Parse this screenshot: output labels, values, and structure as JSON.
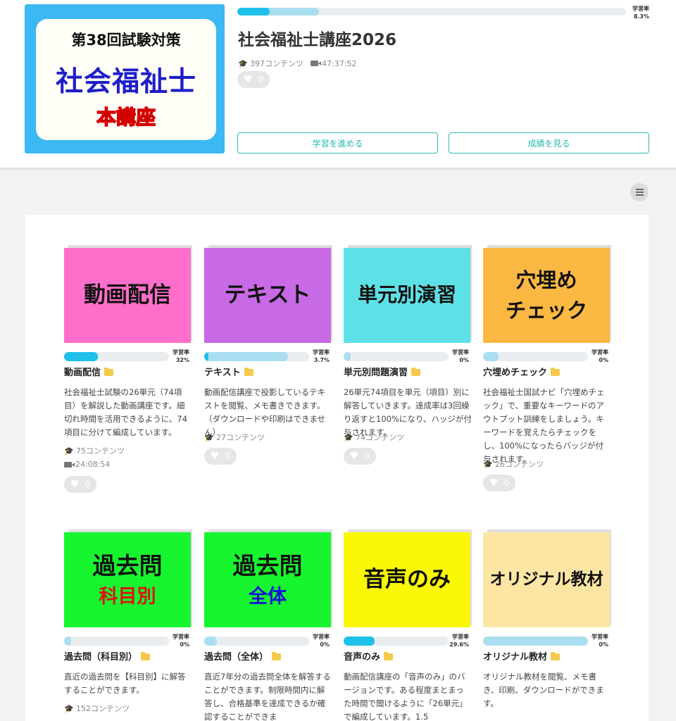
{
  "course": {
    "thumbnail": {
      "line1": "第38回試験対策",
      "line2": "社会福祉士",
      "line3": "本講座"
    },
    "title": "社会福祉士講座2026",
    "contents": "397コンテンツ",
    "duration": "47:37:52",
    "likes": "0",
    "progress": {
      "rate_label": "学習率",
      "rate": "8.3%",
      "fill": 0.083,
      "buffer": 0.21
    }
  },
  "buttons": {
    "study": "学習を進める",
    "score": "成績を見る"
  },
  "icons": {
    "contents": "graduation-cap-icon",
    "duration": "video-camera-icon",
    "like": "heart-icon",
    "folder": "folder-icon",
    "list": "list-icon"
  },
  "colors": {
    "accent": "#29b8b0",
    "progress": "#1fc0ea",
    "progress_buffer": "#a9def0"
  },
  "cards": [
    {
      "thumb_lines": [
        "動画配信"
      ],
      "thumb_bg": "#ff6ecb",
      "title": "動画配信",
      "rate_label": "学習率",
      "rate": "32%",
      "fill": 0.32,
      "buffer": 0.32,
      "desc": "社会福祉士試験の26単元（74項目）を解説した動画講座です。細切れ時間を活用できるように、74項目に分けて編成しています。",
      "contents": "75コンテンツ",
      "duration": "24:08:54",
      "likes": "0"
    },
    {
      "thumb_lines": [
        "テキスト"
      ],
      "thumb_bg": "#c86ae6",
      "title": "テキスト",
      "rate_label": "学習率",
      "rate": "3.7%",
      "fill": 0.037,
      "buffer": 0.8,
      "desc": "動画配信講座で投影しているテキストを閲覧、メモ書きできます。（ダウンロードや印刷はできません）",
      "contents": "27コンテンツ",
      "likes": "0"
    },
    {
      "thumb_lines": [
        "単元別演習"
      ],
      "thumb_bg": "#5ce1e6",
      "title": "単元別問題演習",
      "rate_label": "学習率",
      "rate": "0%",
      "fill": 0,
      "buffer": 0.07,
      "desc": "26単元74項目を単元（項目）別に解答していきます。達成率は3回繰り返すと100%になり、ハッジが付与されます。",
      "contents": "74コンテンツ",
      "likes": "0"
    },
    {
      "thumb_lines": [
        "穴埋め",
        "チェック"
      ],
      "thumb_bg": "#fbb843",
      "title": "穴埋めチェック",
      "rate_label": "学習率",
      "rate": "0%",
      "fill": 0,
      "buffer": 0.15,
      "desc": "社会福祉士国試ナビ「穴埋めチェック」で、重要なキーワードのアウトプット訓練をしましょう。キーワードを覚えたらチェックをし、100%になったらバッジが付与されます。",
      "contents": "26コンテンツ",
      "likes": "0"
    },
    {
      "thumb_lines": [
        "過去問",
        "科目別"
      ],
      "thumb_bg": "#17f52e",
      "title": "過去問（科目別）",
      "rate_label": "学習率",
      "rate": "0%",
      "fill": 0,
      "buffer": 0.07,
      "desc": "直近の過去問を【科目別】に解答することができます。",
      "contents": "152コンテンツ"
    },
    {
      "thumb_lines": [
        "過去問",
        "全体"
      ],
      "thumb_bg": "#17f52e",
      "title": "過去問（全体）",
      "rate_label": "学習率",
      "rate": "0%",
      "fill": 0,
      "buffer": 0.12,
      "desc": "直近7年分の過去問全体を解答することができます。制限時間内に解答し、合格基準を達成できるか確認することができま"
    },
    {
      "thumb_lines": [
        "音声のみ"
      ],
      "thumb_bg": "#faf804",
      "title": "音声のみ",
      "rate_label": "学習率",
      "rate": "29.6%",
      "fill": 0.296,
      "buffer": 0.296,
      "desc": "動画配信講座の「音声のみ」のバージョンです。ある程度まとまった時間で聞けるように「26単元」で編成しています。1.5"
    },
    {
      "thumb_lines": [
        "オリジナル教材"
      ],
      "thumb_bg": "#fde5a4",
      "title": "オリジナル教材",
      "rate_label": "学習率",
      "rate": "0%",
      "fill": 0,
      "buffer": 1.0,
      "desc": "オリジナル教材を閲覧、メモ書き、印刷、ダウンロードができます。"
    }
  ]
}
